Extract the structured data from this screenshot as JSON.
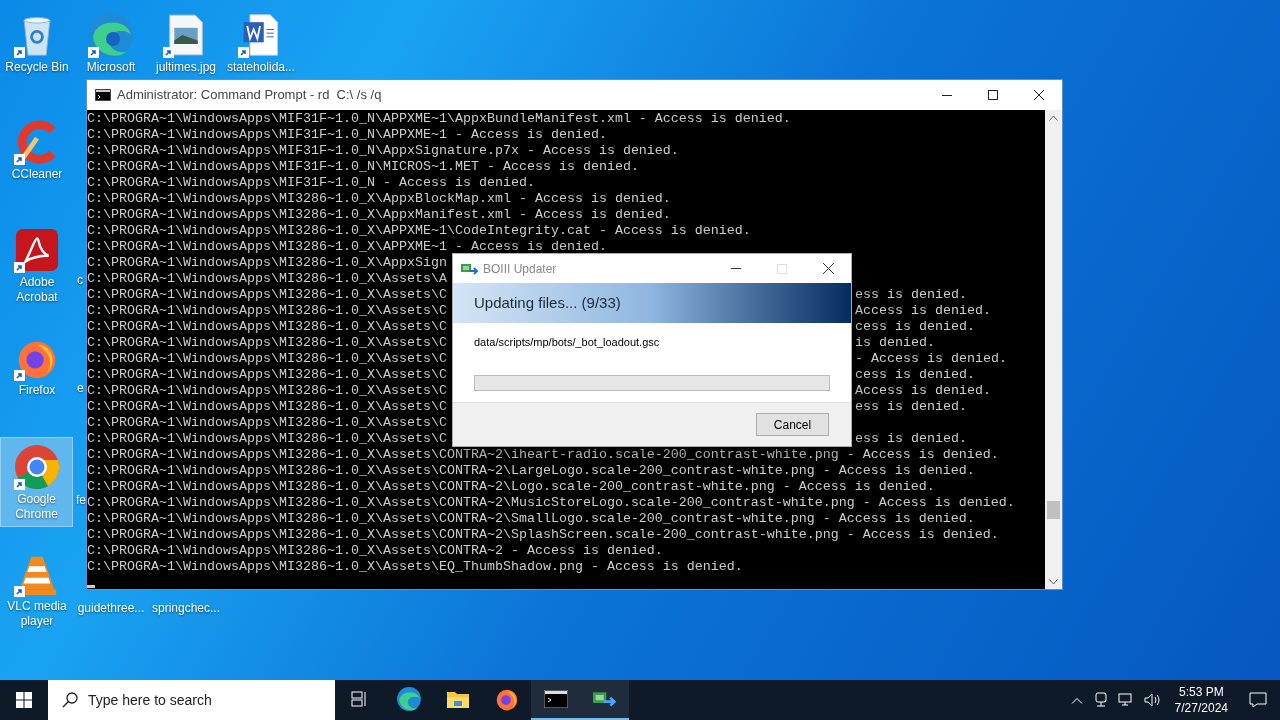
{
  "desktop_icons": [
    {
      "kind": "recycle",
      "label": "Recycle Bin",
      "selected": false
    },
    {
      "kind": "edge",
      "label": "Microsoft",
      "selected": false
    },
    {
      "kind": "image",
      "label": "jultimes.jpg",
      "selected": false
    },
    {
      "kind": "word",
      "label": "stateholida...",
      "selected": false
    },
    {
      "kind": "ccleaner",
      "label": "CCleaner",
      "selected": false
    },
    {
      "kind": "acrobat",
      "label": "Adobe Acrobat",
      "selected": false
    },
    {
      "kind": "firefox",
      "label": "Firefox",
      "selected": false
    },
    {
      "kind": "chrome",
      "label": "Google Chrome",
      "selected": true
    },
    {
      "kind": "vlc",
      "label": "VLC media player",
      "selected": false
    },
    {
      "kind": "hidden",
      "label": "guidethree...",
      "selected": false
    },
    {
      "kind": "hidden",
      "label": "springchec...",
      "selected": false
    },
    {
      "kind": "fragment",
      "label": "c",
      "selected": false
    },
    {
      "kind": "fragment",
      "label": "e",
      "selected": false
    },
    {
      "kind": "fragment",
      "label": "fe",
      "selected": false
    }
  ],
  "console": {
    "title": "Administrator: Command Prompt - rd  C:\\ /s /q",
    "lines": [
      {
        "left": "C:\\PROGRA~1\\WindowsApps\\MIF31F~1.0_N\\APPXME~1\\AppxBundleManifest.xml - Access is denied."
      },
      {
        "left": "C:\\PROGRA~1\\WindowsApps\\MIF31F~1.0_N\\APPXME~1 - Access is denied."
      },
      {
        "left": "C:\\PROGRA~1\\WindowsApps\\MIF31F~1.0_N\\AppxSignature.p7x - Access is denied."
      },
      {
        "left": "C:\\PROGRA~1\\WindowsApps\\MIF31F~1.0_N\\MICROS~1.MET - Access is denied."
      },
      {
        "left": "C:\\PROGRA~1\\WindowsApps\\MIF31F~1.0_N - Access is denied."
      },
      {
        "left": "C:\\PROGRA~1\\WindowsApps\\MI3286~1.0_X\\AppxBlockMap.xml - Access is denied."
      },
      {
        "left": "C:\\PROGRA~1\\WindowsApps\\MI3286~1.0_X\\AppxManifest.xml - Access is denied."
      },
      {
        "left": "C:\\PROGRA~1\\WindowsApps\\MI3286~1.0_X\\APPXME~1\\CodeIntegrity.cat - Access is denied."
      },
      {
        "left": "C:\\PROGRA~1\\WindowsApps\\MI3286~1.0_X\\APPXME~1 - Access is denied."
      },
      {
        "left": "C:\\PROGRA~1\\WindowsApps\\MI3286~1.0_X\\AppxSign"
      },
      {
        "left": "C:\\PROGRA~1\\WindowsApps\\MI3286~1.0_X\\Assets\\A"
      },
      {
        "left": "C:\\PROGRA~1\\WindowsApps\\MI3286~1.0_X\\Assets\\C",
        "right": "ess is denied."
      },
      {
        "left": "C:\\PROGRA~1\\WindowsApps\\MI3286~1.0_X\\Assets\\C",
        "right": "Access is denied."
      },
      {
        "left": "C:\\PROGRA~1\\WindowsApps\\MI3286~1.0_X\\Assets\\C",
        "right": "cess is denied."
      },
      {
        "left": "C:\\PROGRA~1\\WindowsApps\\MI3286~1.0_X\\Assets\\C",
        "right": "is denied."
      },
      {
        "left": "C:\\PROGRA~1\\WindowsApps\\MI3286~1.0_X\\Assets\\C",
        "right": "- Access is denied."
      },
      {
        "left": "C:\\PROGRA~1\\WindowsApps\\MI3286~1.0_X\\Assets\\C",
        "right": "cess is denied."
      },
      {
        "left": "C:\\PROGRA~1\\WindowsApps\\MI3286~1.0_X\\Assets\\C",
        "right": "Access is denied."
      },
      {
        "left": "C:\\PROGRA~1\\WindowsApps\\MI3286~1.0_X\\Assets\\C",
        "right": "ess is denied."
      },
      {
        "left": "C:\\PROGRA~1\\WindowsApps\\MI3286~1.0_X\\Assets\\C"
      },
      {
        "left": "C:\\PROGRA~1\\WindowsApps\\MI3286~1.0_X\\Assets\\C",
        "right": "ess is denied."
      },
      {
        "left": "C:\\PROGRA~1\\WindowsApps\\MI3286~1.0_X\\Assets\\CONTRA~2\\iheart-radio.scale-200_contrast-white.png - Access is denied."
      },
      {
        "left": "C:\\PROGRA~1\\WindowsApps\\MI3286~1.0_X\\Assets\\CONTRA~2\\LargeLogo.scale-200_contrast-white.png - Access is denied."
      },
      {
        "left": "C:\\PROGRA~1\\WindowsApps\\MI3286~1.0_X\\Assets\\CONTRA~2\\Logo.scale-200_contrast-white.png - Access is denied."
      },
      {
        "left": "C:\\PROGRA~1\\WindowsApps\\MI3286~1.0_X\\Assets\\CONTRA~2\\MusicStoreLogo.scale-200_contrast-white.png - Access is denied."
      },
      {
        "left": "C:\\PROGRA~1\\WindowsApps\\MI3286~1.0_X\\Assets\\CONTRA~2\\SmallLogo.scale-200_contrast-white.png - Access is denied."
      },
      {
        "left": "C:\\PROGRA~1\\WindowsApps\\MI3286~1.0_X\\Assets\\CONTRA~2\\SplashScreen.scale-200_contrast-white.png - Access is denied."
      },
      {
        "left": "C:\\PROGRA~1\\WindowsApps\\MI3286~1.0_X\\Assets\\CONTRA~2 - Access is denied."
      },
      {
        "left": "C:\\PROGRA~1\\WindowsApps\\MI3286~1.0_X\\Assets\\EQ_ThumbShadow.png - Access is denied."
      }
    ]
  },
  "dialog": {
    "title": "BOIII Updater",
    "heading": "Updating files... (9/33)",
    "file": "data/scripts/mp/bots/_bot_loadout.gsc",
    "progress": {
      "level": 0
    },
    "button": "Cancel"
  },
  "taskbar": {
    "search_placeholder": "Type here to search",
    "apps": [
      {
        "kind": "taskview",
        "active": false
      },
      {
        "kind": "edge",
        "active": false
      },
      {
        "kind": "explorer",
        "active": false
      },
      {
        "kind": "firefox",
        "active": false
      },
      {
        "kind": "cmd",
        "active": true
      },
      {
        "kind": "updater",
        "active": true
      }
    ],
    "time": "5:53 PM",
    "date": "7/27/2024"
  }
}
